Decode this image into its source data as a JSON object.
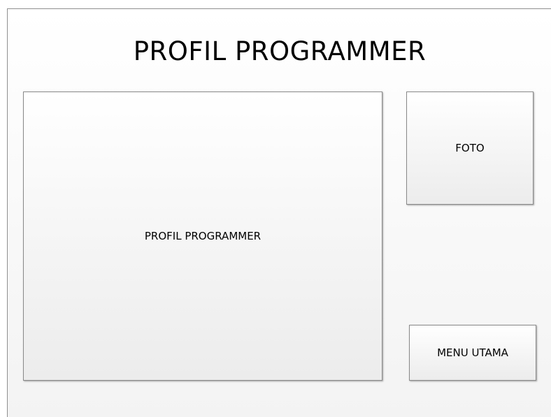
{
  "page": {
    "title": "PROFIL PROGRAMMER"
  },
  "profile_panel": {
    "label": "PROFIL PROGRAMMER"
  },
  "photo_panel": {
    "label": "FOTO"
  },
  "menu_button": {
    "label": "MENU UTAMA"
  }
}
